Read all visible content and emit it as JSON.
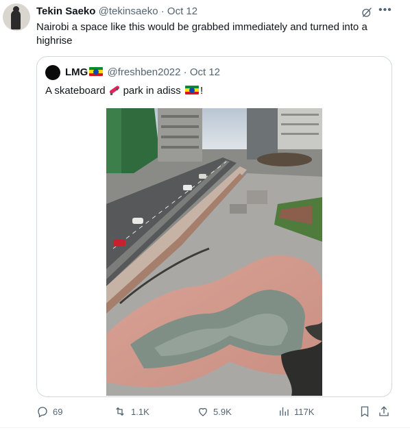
{
  "tweet": {
    "author_name": "Tekin Saeko",
    "author_handle": "@tekinsaeko",
    "separator": "·",
    "date": "Oct 12",
    "text": "Nairobi a space like this would be grabbed immediately and turned into a highrise",
    "more_icon": "more-horizontal-icon",
    "grok_icon": "grok-icon"
  },
  "quote": {
    "author_name": "LMG",
    "author_handle": "@freshben2022",
    "separator": "·",
    "date": "Oct 12",
    "text_before": "A skateboard",
    "text_middle": "park in adiss",
    "text_after": "!",
    "flag_icon": "ethiopia-flag-icon",
    "skateboard_icon": "skateboard-emoji-icon",
    "image_alt": "Aerial view of a skate park beside a city road"
  },
  "actions": {
    "replies": "69",
    "reposts": "1.1K",
    "likes": "5.9K",
    "views": "117K"
  },
  "colors": {
    "text": "#0f1419",
    "muted": "#536471",
    "border": "#cfd9de"
  }
}
